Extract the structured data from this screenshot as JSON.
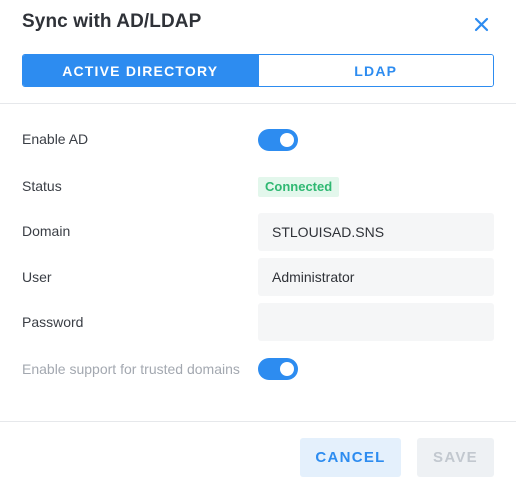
{
  "dialog": {
    "title": "Sync with AD/LDAP",
    "close_icon": "close-icon"
  },
  "tabs": [
    {
      "label": "ACTIVE DIRECTORY",
      "active": true
    },
    {
      "label": "LDAP",
      "active": false
    }
  ],
  "form": {
    "enable_ad": {
      "label": "Enable AD",
      "value": true
    },
    "status": {
      "label": "Status",
      "value": "Connected"
    },
    "domain": {
      "label": "Domain",
      "value": "STLOUISAD.SNS",
      "placeholder": ""
    },
    "user": {
      "label": "User",
      "value": "Administrator",
      "placeholder": ""
    },
    "password": {
      "label": "Password",
      "value": "",
      "placeholder": ""
    },
    "trusted_domains": {
      "label": "Enable support for trusted domains",
      "value": true
    }
  },
  "footer": {
    "cancel_label": "CANCEL",
    "save_label": "SAVE"
  },
  "colors": {
    "accent": "#2d8cf0",
    "status_connected_bg": "#e3f7ec",
    "status_connected_text": "#2fb872"
  }
}
